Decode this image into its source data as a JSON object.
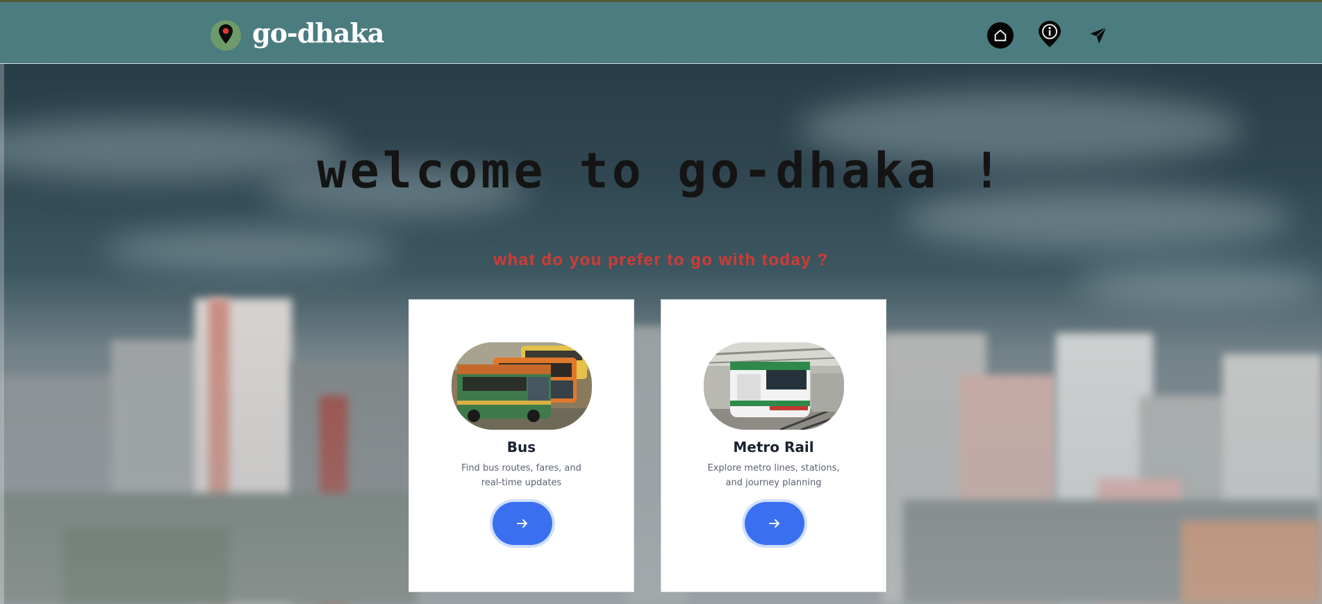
{
  "header": {
    "brand": "go-dhaka",
    "logo_icon": "map-pin-icon",
    "nav": [
      {
        "icon": "home-icon"
      },
      {
        "icon": "info-pin-icon"
      },
      {
        "icon": "send-icon"
      }
    ]
  },
  "hero": {
    "title": "welcome to go-dhaka !",
    "subtitle": "what do you prefer to go with today ?"
  },
  "cards": [
    {
      "title": "Bus",
      "description": "Find bus routes, fares, and real-time updates",
      "image": "bus-photo",
      "action_icon": "arrow-right-icon"
    },
    {
      "title": "Metro Rail",
      "description": "Explore metro lines, stations, and journey planning",
      "image": "metro-rail-photo",
      "action_icon": "arrow-right-icon"
    }
  ],
  "colors": {
    "header_bg": "#4b7c80",
    "accent_red": "#d53a32",
    "button_blue": "#3a6ff0"
  }
}
